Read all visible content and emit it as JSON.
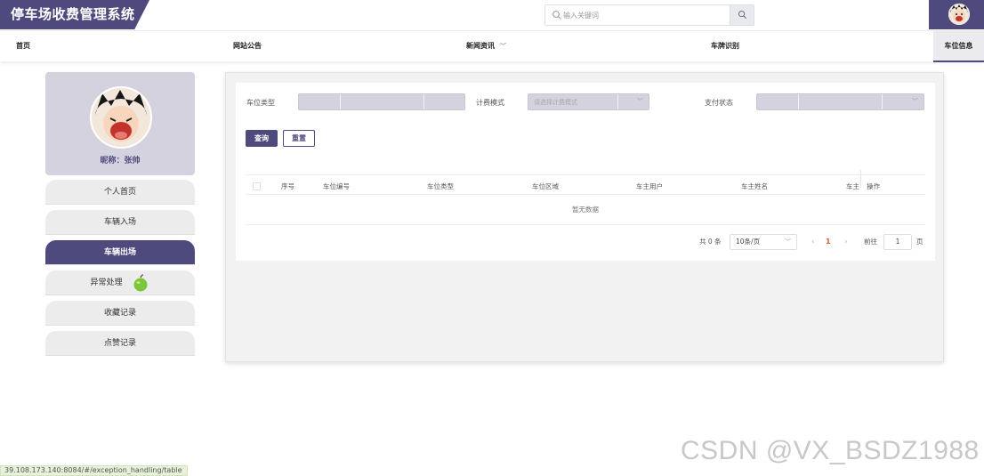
{
  "app": {
    "title": "停车场收费管理系统"
  },
  "search": {
    "placeholder": "输入关键词"
  },
  "nav": {
    "items": [
      "首页",
      "网站公告",
      "新闻资讯",
      "车牌识别",
      "车位信息"
    ],
    "active": "车位信息"
  },
  "sidebar": {
    "nickname": "昵称：张帅",
    "items": [
      "个人首页",
      "车辆入场",
      "车辆出场",
      "异常处理",
      "收藏记录",
      "点赞记录"
    ],
    "active": "车辆出场"
  },
  "filters": {
    "type_label": "车位类型",
    "mode_label": "计费模式",
    "mode_placeholder": "请选择计费模式",
    "pay_label": "支付状态",
    "query_button": "查询",
    "reset_button": "重置"
  },
  "table": {
    "columns": [
      "序号",
      "车位编号",
      "车位类型",
      "车位区域",
      "车主用户",
      "车主姓名",
      "车主",
      "操作"
    ],
    "empty_text": "暂无数据"
  },
  "pagination": {
    "total_text": "共 0 条",
    "page_size": "10条/页",
    "current_page": "1",
    "goto_label": "前往",
    "goto_value": "1",
    "page_suffix": "页"
  },
  "status_url": "39.108.173.140:8084/#/exception_handling/table",
  "watermark": "CSDN @VX_BSDZ1988",
  "colors": {
    "primary": "#4f4a7e",
    "accent": "#e2572b"
  }
}
